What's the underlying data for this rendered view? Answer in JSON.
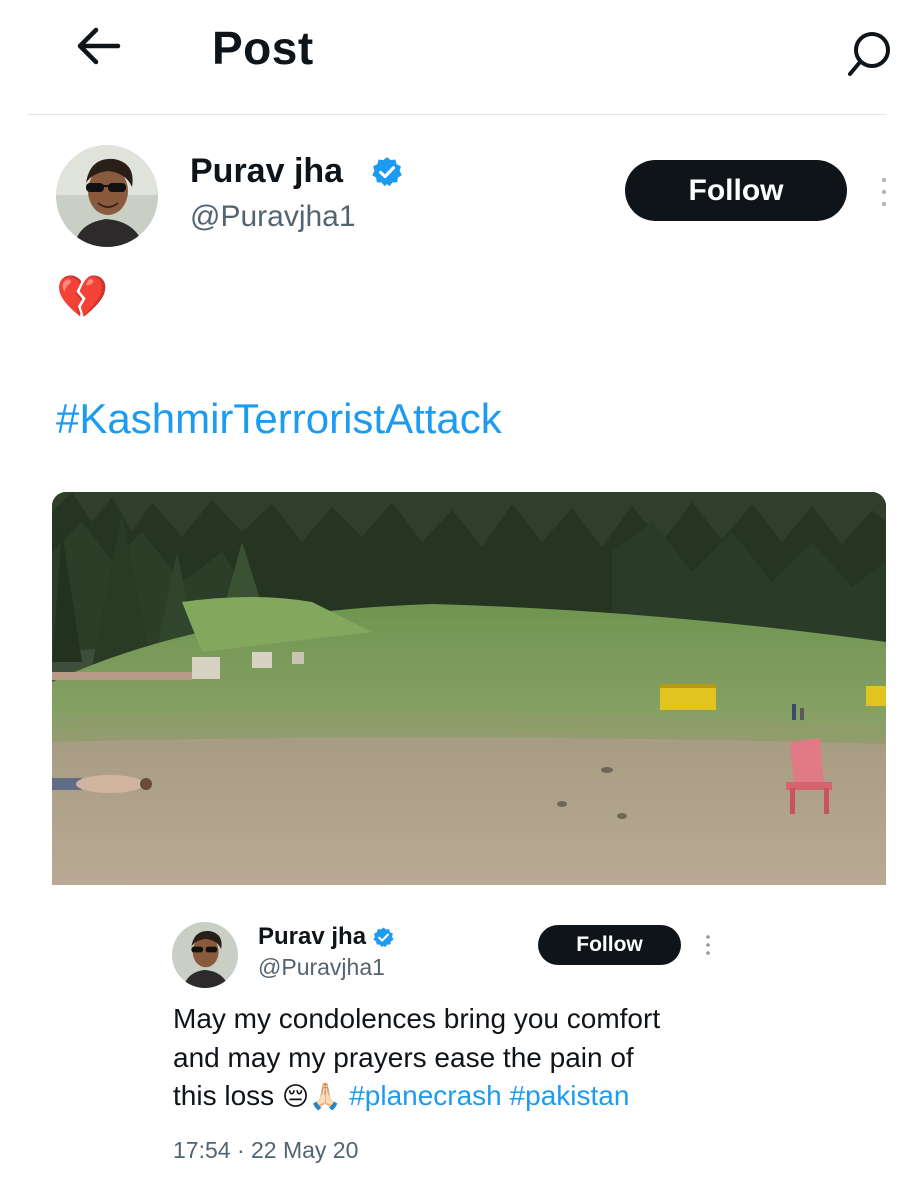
{
  "header": {
    "title": "Post",
    "back_icon": "arrow-left-icon",
    "search_icon": "search-icon"
  },
  "author": {
    "name": "Purav jha",
    "handle": "@Puravjha1",
    "verified": true,
    "follow_label": "Follow"
  },
  "post": {
    "emoji": "💔",
    "hashtag": "#KashmirTerroristAttack",
    "image_alt": "meadow-with-pine-forest"
  },
  "quoted": {
    "name": "Purav jha",
    "handle": "@Puravjha1",
    "follow_label": "Follow",
    "text_line1": "May my condolences bring you comfort",
    "text_line2": "and may my prayers ease the pain of",
    "text_line3_start": "this loss",
    "emoji_pensive": "😔",
    "emoji_pray": "🙏🏻",
    "hashtag1": "#planecrash",
    "hashtag2": "#pakistan",
    "timestamp": "17:54 · 22 May 20"
  },
  "colors": {
    "accent": "#1d9bf0",
    "text": "#0f1419",
    "muted": "#536471",
    "verified": "#1d9bf0"
  }
}
